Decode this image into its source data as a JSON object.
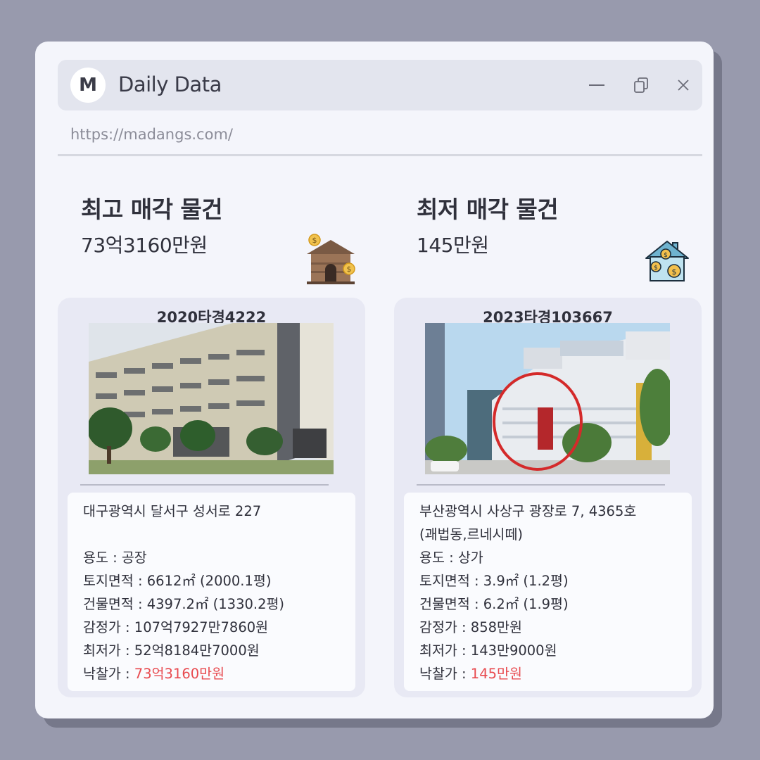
{
  "window": {
    "avatar_letter": "M",
    "title": "Daily Data",
    "url": "https://madangs.com/"
  },
  "highest": {
    "heading": "최고 매각 물건",
    "price": "73억3160만원",
    "case_no": "2020타경4222",
    "address": "대구광역시 달서구 성서로 227",
    "usage": "용도 : 공장",
    "land_area": "토지면적 : 6612㎡ (2000.1평)",
    "building_area": "건물면적 : 4397.2㎡ (1330.2평)",
    "appraisal": "감정가 : 107억7927만7860원",
    "minimum": "최저가 : 52억8184만7000원",
    "winning_label": "낙찰가 : ",
    "winning_value": "73억3160만원"
  },
  "lowest": {
    "heading": "최저 매각 물건",
    "price": "145만원",
    "case_no": "2023타경103667",
    "address_line1": "부산광역시 사상구 광장로 7, 4365호",
    "address_line2": "(괘법동,르네시떼)",
    "usage": "용도 : 상가",
    "land_area": "토지면적 :  3.9㎡ (1.2평)",
    "building_area": "건물면적 : 6.2㎡ (1.9평)",
    "appraisal": "감정가 : 858만원",
    "minimum": "최저가 : 143만9000원",
    "winning_label": "낙찰가 : ",
    "winning_value": "145만원"
  },
  "colors": {
    "background": "#989aad",
    "window": "#f4f5fb",
    "card": "#e8e9f4",
    "highlight": "#e84a4f"
  },
  "icons": {
    "minimize": "minimize-icon",
    "copy": "copy-windows-icon",
    "close": "close-icon",
    "house_money_brown": "house-money-icon",
    "house_money_blue": "house-coins-icon"
  }
}
